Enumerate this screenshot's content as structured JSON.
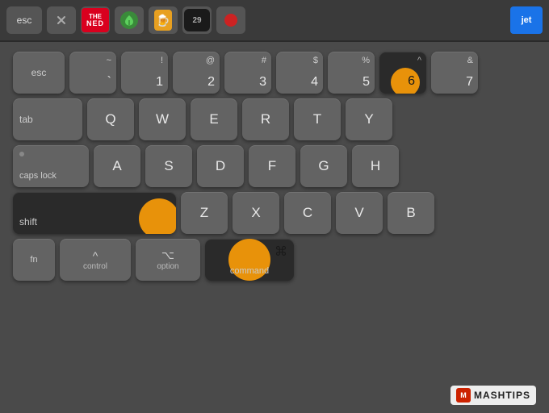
{
  "touchbar": {
    "esc_label": "esc",
    "jet_label": "jet",
    "ned_label": "NED",
    "icon_29": "29",
    "icons": [
      "close-circle",
      "ned-icon",
      "leaf-icon",
      "beer-icon",
      "29-icon",
      "record-icon",
      "jet-icon"
    ]
  },
  "keyboard": {
    "rows": {
      "number_row": [
        {
          "top": "~",
          "bot": "`"
        },
        {
          "top": "!",
          "bot": "1"
        },
        {
          "top": "@",
          "bot": "2"
        },
        {
          "top": "#",
          "bot": "3"
        },
        {
          "top": "$",
          "bot": "4"
        },
        {
          "top": "%",
          "bot": "5"
        },
        {
          "top": "^",
          "bot": "6",
          "highlighted": true
        },
        {
          "top": "&",
          "bot": "7"
        }
      ],
      "qwerty_row": [
        "Q",
        "W",
        "E",
        "R",
        "T",
        "Y"
      ],
      "asdf_row": [
        "A",
        "S",
        "D",
        "F",
        "G",
        "H"
      ],
      "zxcv_row": [
        "Z",
        "X",
        "C",
        "V",
        "B"
      ],
      "bottom_row": {
        "fn": "fn",
        "control_sym": "^",
        "control_label": "control",
        "option_sym": "⌥",
        "option_label": "option",
        "cmd_sym": "⌘",
        "cmd_label": "command"
      }
    },
    "special_keys": {
      "esc": "esc",
      "tab": "tab",
      "caps_lock": "caps lock",
      "shift": "shift"
    }
  },
  "watermark": {
    "icon_text": "M",
    "brand": "MASHTIPS"
  },
  "colors": {
    "orange": "#e8920a",
    "key_normal": "#636363",
    "key_dark": "#2a2a2a",
    "keyboard_bg": "#4a4a4a"
  }
}
